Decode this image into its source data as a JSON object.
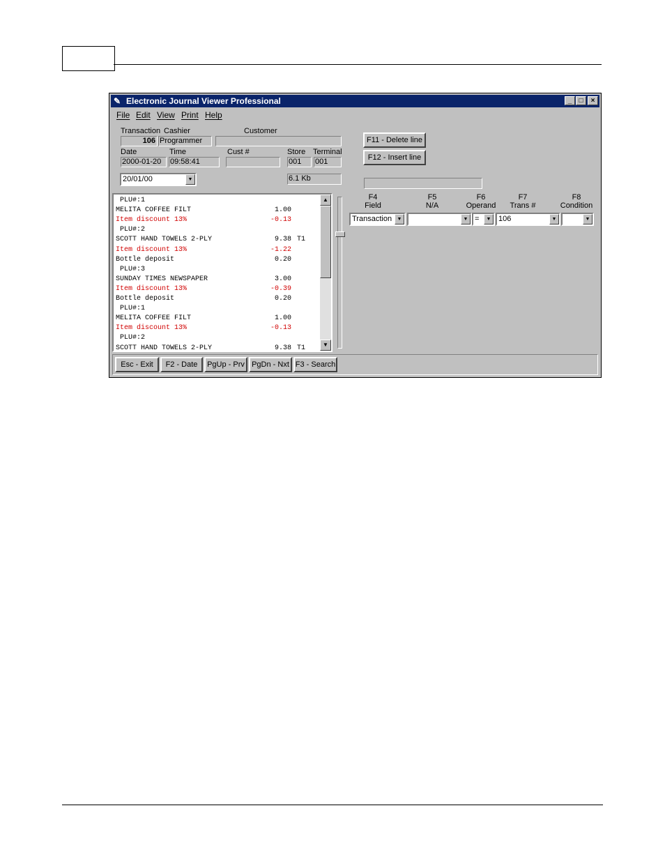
{
  "window": {
    "title": "Electronic Journal Viewer Professional",
    "controls": {
      "minimize": "_",
      "maximize": "□",
      "close": "×"
    }
  },
  "menu": [
    "File",
    "Edit",
    "View",
    "Print",
    "Help"
  ],
  "header": {
    "transaction_label": "Transaction",
    "cashier_label": "Cashier",
    "customer_label": "Customer",
    "transaction_value": "106",
    "cashier_value": "Programmer",
    "customer_value": "",
    "date_label": "Date",
    "time_label": "Time",
    "cust_label": "Cust #",
    "store_label": "Store",
    "terminal_label": "Terminal",
    "date_value": "2000-01-20",
    "time_value": "09:58:41",
    "cust_value": "",
    "store_value": "001",
    "terminal_value": "001",
    "date_select": "20/01/00",
    "size_value": "6.1 Kb"
  },
  "buttons": {
    "delete_line": "F11 - Delete line",
    "insert_line": "F12 - Insert line"
  },
  "search": {
    "progress_value": "",
    "f4_key": "F4",
    "f4_label": "Field",
    "f4_value": "Transaction",
    "f5_key": "F5",
    "f5_label": "N/A",
    "f5_value": "",
    "f6_key": "F6",
    "f6_label": "Operand",
    "f6_value": "=",
    "f7_key": "F7",
    "f7_label": "Trans #",
    "f7_value": "106",
    "f8_key": "F8",
    "f8_label": "Condition",
    "f8_value": ""
  },
  "journal": [
    {
      "text": " PLU#:1",
      "amount": "",
      "tax": "",
      "red": false
    },
    {
      "text": "MELITA COFFEE FILT",
      "amount": "1.00",
      "tax": "",
      "red": false
    },
    {
      "text": "Item discount 13%",
      "amount": "-0.13",
      "tax": "",
      "red": true
    },
    {
      "text": " PLU#:2",
      "amount": "",
      "tax": "",
      "red": false
    },
    {
      "text": "SCOTT HAND TOWELS 2-PLY",
      "amount": "9.38",
      "tax": "T1",
      "red": false
    },
    {
      "text": "Item discount 13%",
      "amount": "-1.22",
      "tax": "",
      "red": true
    },
    {
      "text": "Bottle deposit",
      "amount": "0.20",
      "tax": "",
      "red": false
    },
    {
      "text": " PLU#:3",
      "amount": "",
      "tax": "",
      "red": false
    },
    {
      "text": "SUNDAY TIMES NEWSPAPER",
      "amount": "3.00",
      "tax": "",
      "red": false
    },
    {
      "text": "Item discount 13%",
      "amount": "-0.39",
      "tax": "",
      "red": true
    },
    {
      "text": "Bottle deposit",
      "amount": "0.20",
      "tax": "",
      "red": false
    },
    {
      "text": " PLU#:1",
      "amount": "",
      "tax": "",
      "red": false
    },
    {
      "text": "MELITA COFFEE FILT",
      "amount": "1.00",
      "tax": "",
      "red": false
    },
    {
      "text": "Item discount 13%",
      "amount": "-0.13",
      "tax": "",
      "red": true
    },
    {
      "text": " PLU#:2",
      "amount": "",
      "tax": "",
      "red": false
    },
    {
      "text": "SCOTT HAND TOWELS 2-PLY",
      "amount": "9.38",
      "tax": "T1",
      "red": false
    }
  ],
  "footer_buttons": [
    "Esc - Exit",
    "F2 - Date",
    "PgUp - Prv",
    "PgDn - Nxt",
    "F3 - Search"
  ],
  "colors": {
    "titlebar": "#0a246a",
    "window": "#c0c0c0",
    "discount_text": "#d00000"
  }
}
